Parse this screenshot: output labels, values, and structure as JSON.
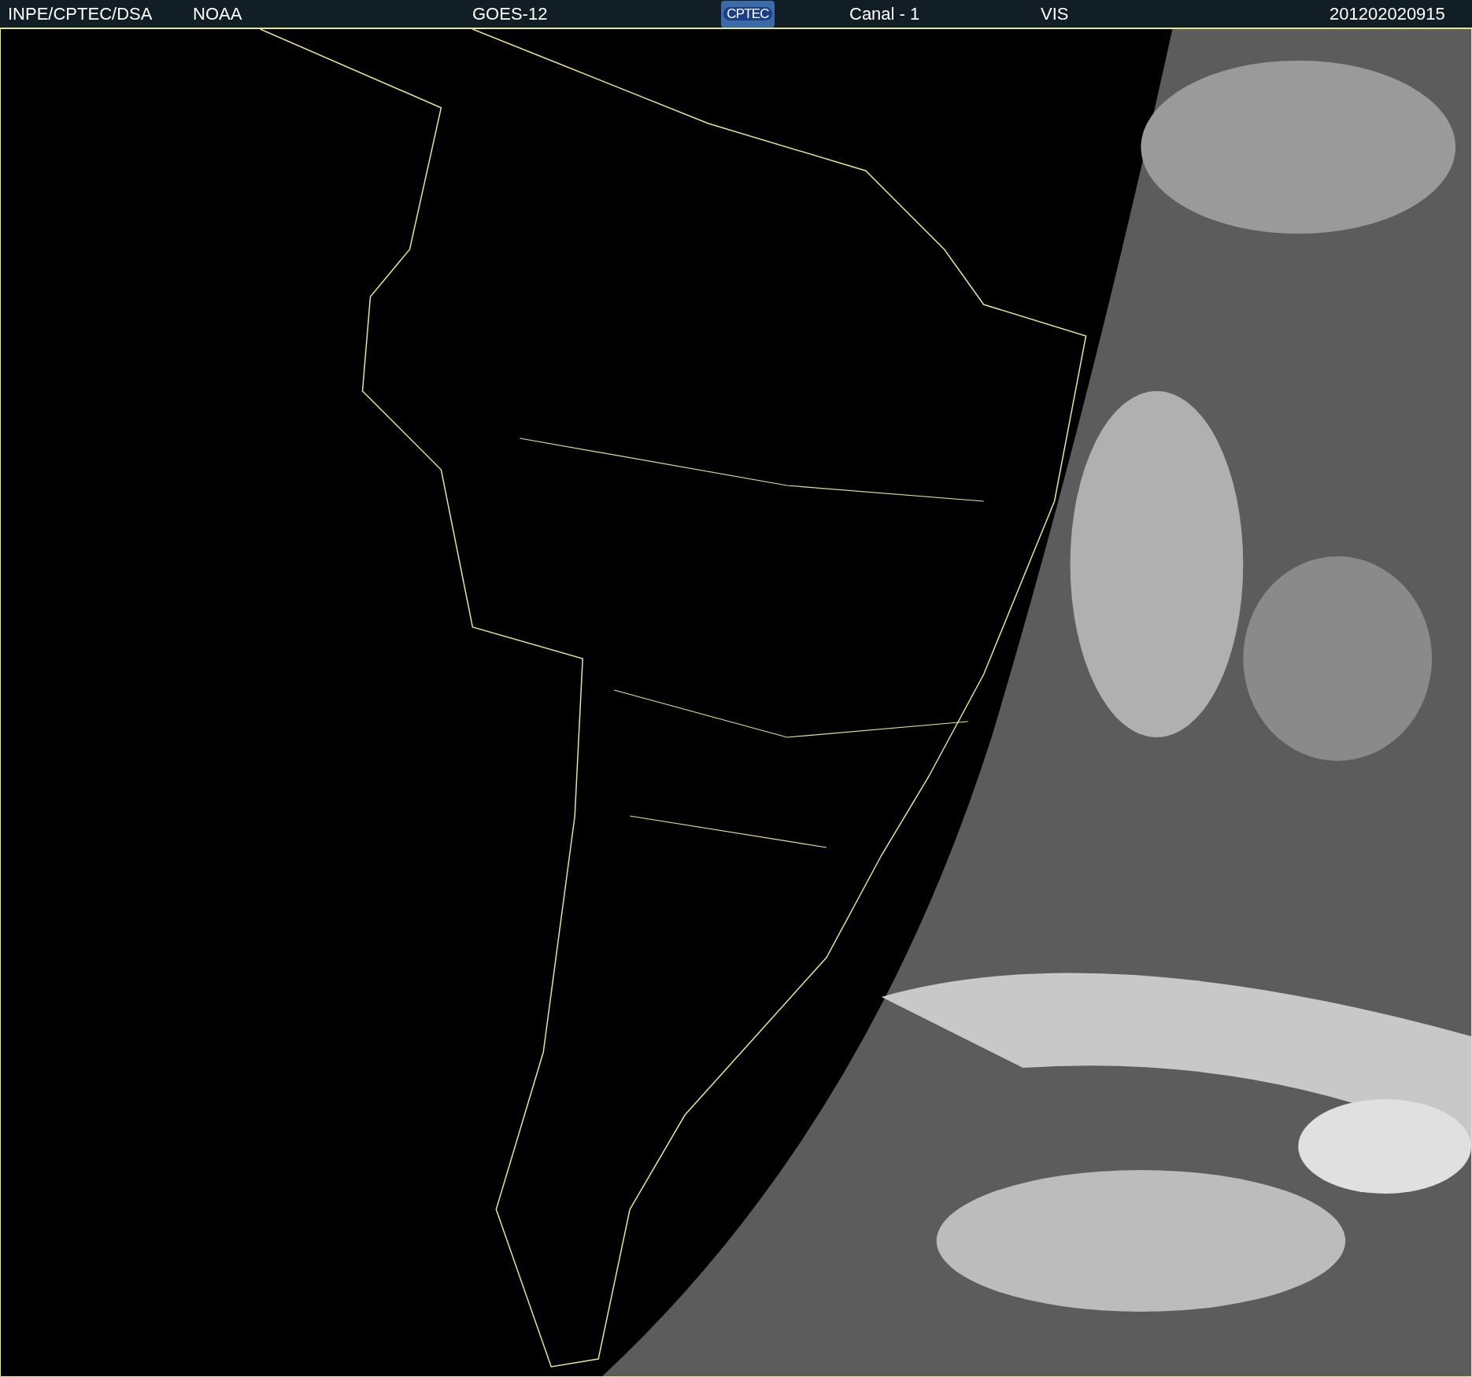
{
  "header": {
    "source": "INPE/CPTEC/DSA",
    "agency": "NOAA",
    "satellite": "GOES-12",
    "logo_text": "CPTEC",
    "channel": "Canal - 1",
    "band": "VIS",
    "timestamp": "201202020915"
  }
}
